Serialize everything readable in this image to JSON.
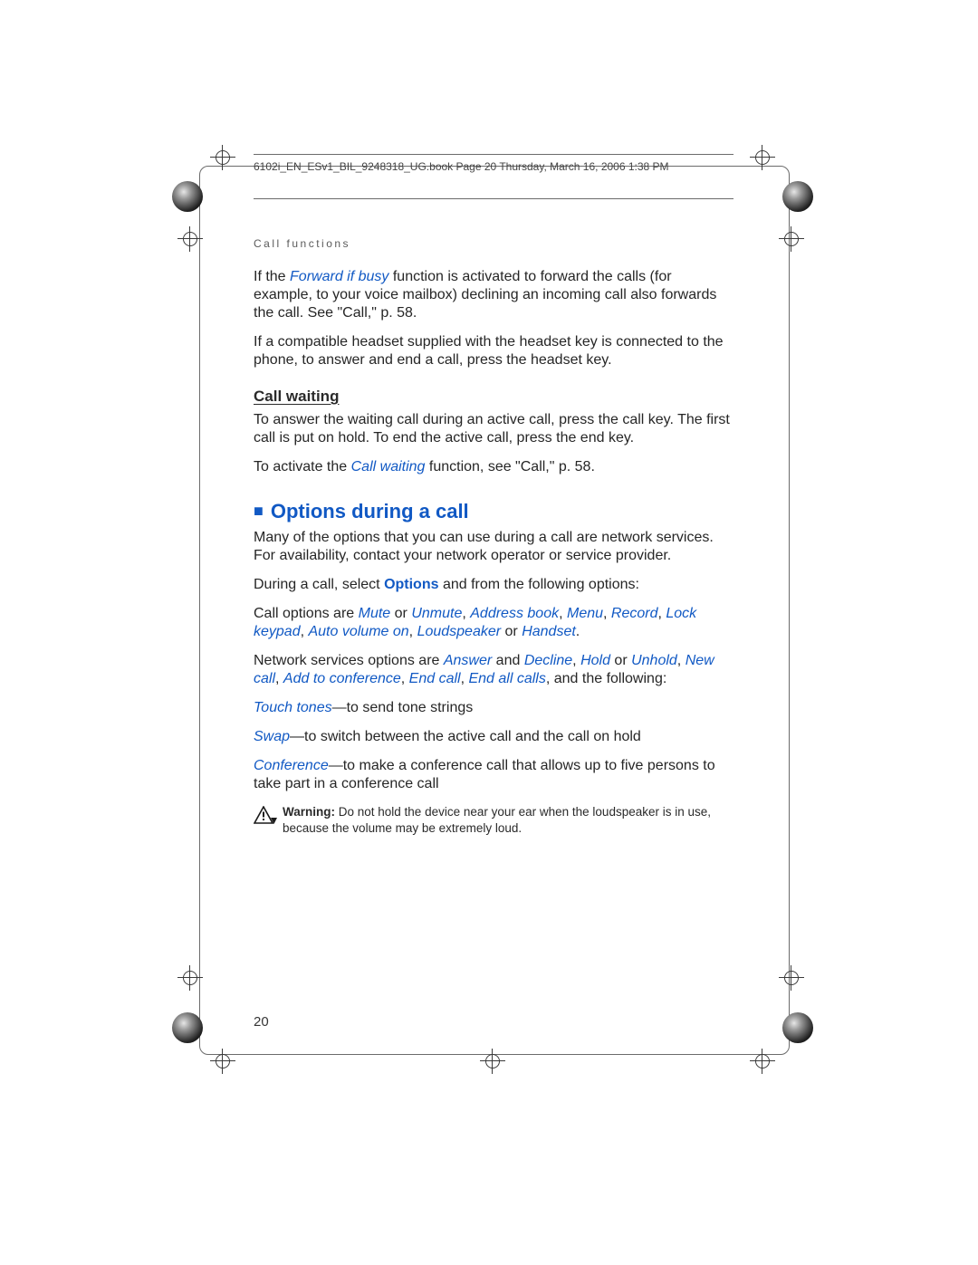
{
  "header": {
    "line": "6102i_EN_ESv1_BIL_9248318_UG.book  Page 20  Thursday, March 16, 2006  1:38 PM"
  },
  "section_label": "Call functions",
  "p1": {
    "pre": "If the ",
    "term": "Forward if busy",
    "post": " function is activated to forward the calls (for example, to your voice mailbox) declining an incoming call also forwards the call. See \"Call,\" p. 58."
  },
  "p2": "If a compatible headset supplied with the headset key is connected to the phone, to answer and end a call, press the headset key.",
  "sub1": "Call waiting",
  "p3": "To answer the waiting call during an active call, press the call key. The first call is put on hold. To end the active call, press the end key.",
  "p4": {
    "pre": "To activate the ",
    "term": "Call waiting",
    "post": " function, see \"Call,\" p. 58."
  },
  "h2": "Options during a call",
  "p5": "Many of the options that you can use during a call are network services. For availability, contact your network operator or service provider.",
  "p6": {
    "pre": "During a call, select ",
    "opt": "Options",
    "post": " and from the following options:"
  },
  "p7": {
    "pre": "Call options are ",
    "mute": "Mute",
    "or1": " or ",
    "unmute": "Unmute",
    "c1": ", ",
    "addr": "Address book",
    "c2": ", ",
    "menu": "Menu",
    "c3": ", ",
    "record": "Record",
    "c4": ", ",
    "lock": "Lock keypad",
    "c5": ", ",
    "auto": "Auto volume on",
    "c6": ", ",
    "loud": "Loudspeaker",
    "or2": " or ",
    "hand": "Handset",
    "end": "."
  },
  "p8": {
    "pre": "Network services options are ",
    "ans": "Answer",
    "and1": " and ",
    "dec": "Decline",
    "c1": ", ",
    "hold": "Hold",
    "or1": " or ",
    "unhold": "Unhold",
    "c2": ", ",
    "newc": "New call",
    "c3": ", ",
    "addc": "Add to conference",
    "c4": ", ",
    "endc": "End call",
    "c5": ", ",
    "endall": "End all calls",
    "post": ", and the following:"
  },
  "p9": {
    "term": "Touch tones",
    "post": "—to send tone strings"
  },
  "p10": {
    "term": "Swap",
    "post": "—to switch between the active call and the call on hold"
  },
  "p11": {
    "term": "Conference",
    "post": "—to make a conference call that allows up to five persons to take part in a conference call"
  },
  "warning": {
    "label": "Warning:",
    "text": " Do not hold the device near your ear when the loudspeaker is in use, because the volume may be extremely loud."
  },
  "page_number": "20"
}
